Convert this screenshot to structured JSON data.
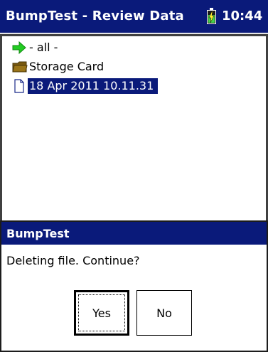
{
  "window": {
    "title": "BumpTest - Review Data",
    "clock": "10:44",
    "battery_icon": "battery-charging-icon",
    "battery_level": 0.6
  },
  "file_list": {
    "items": [
      {
        "label": "- all -",
        "icon": "green-arrow-icon",
        "selected": false
      },
      {
        "label": "Storage Card",
        "icon": "folder-icon",
        "selected": false
      },
      {
        "label": "18 Apr 2011 10.11.31",
        "icon": "document-icon",
        "selected": true
      }
    ]
  },
  "dialog": {
    "title": "BumpTest",
    "message": "Deleting file. Continue?",
    "yes_label": "Yes",
    "no_label": "No"
  },
  "colors": {
    "titlebar": "#0a1a7a",
    "selection": "#0a1a7a",
    "arrow": "#22cc22",
    "folder": "#7a5a10"
  }
}
